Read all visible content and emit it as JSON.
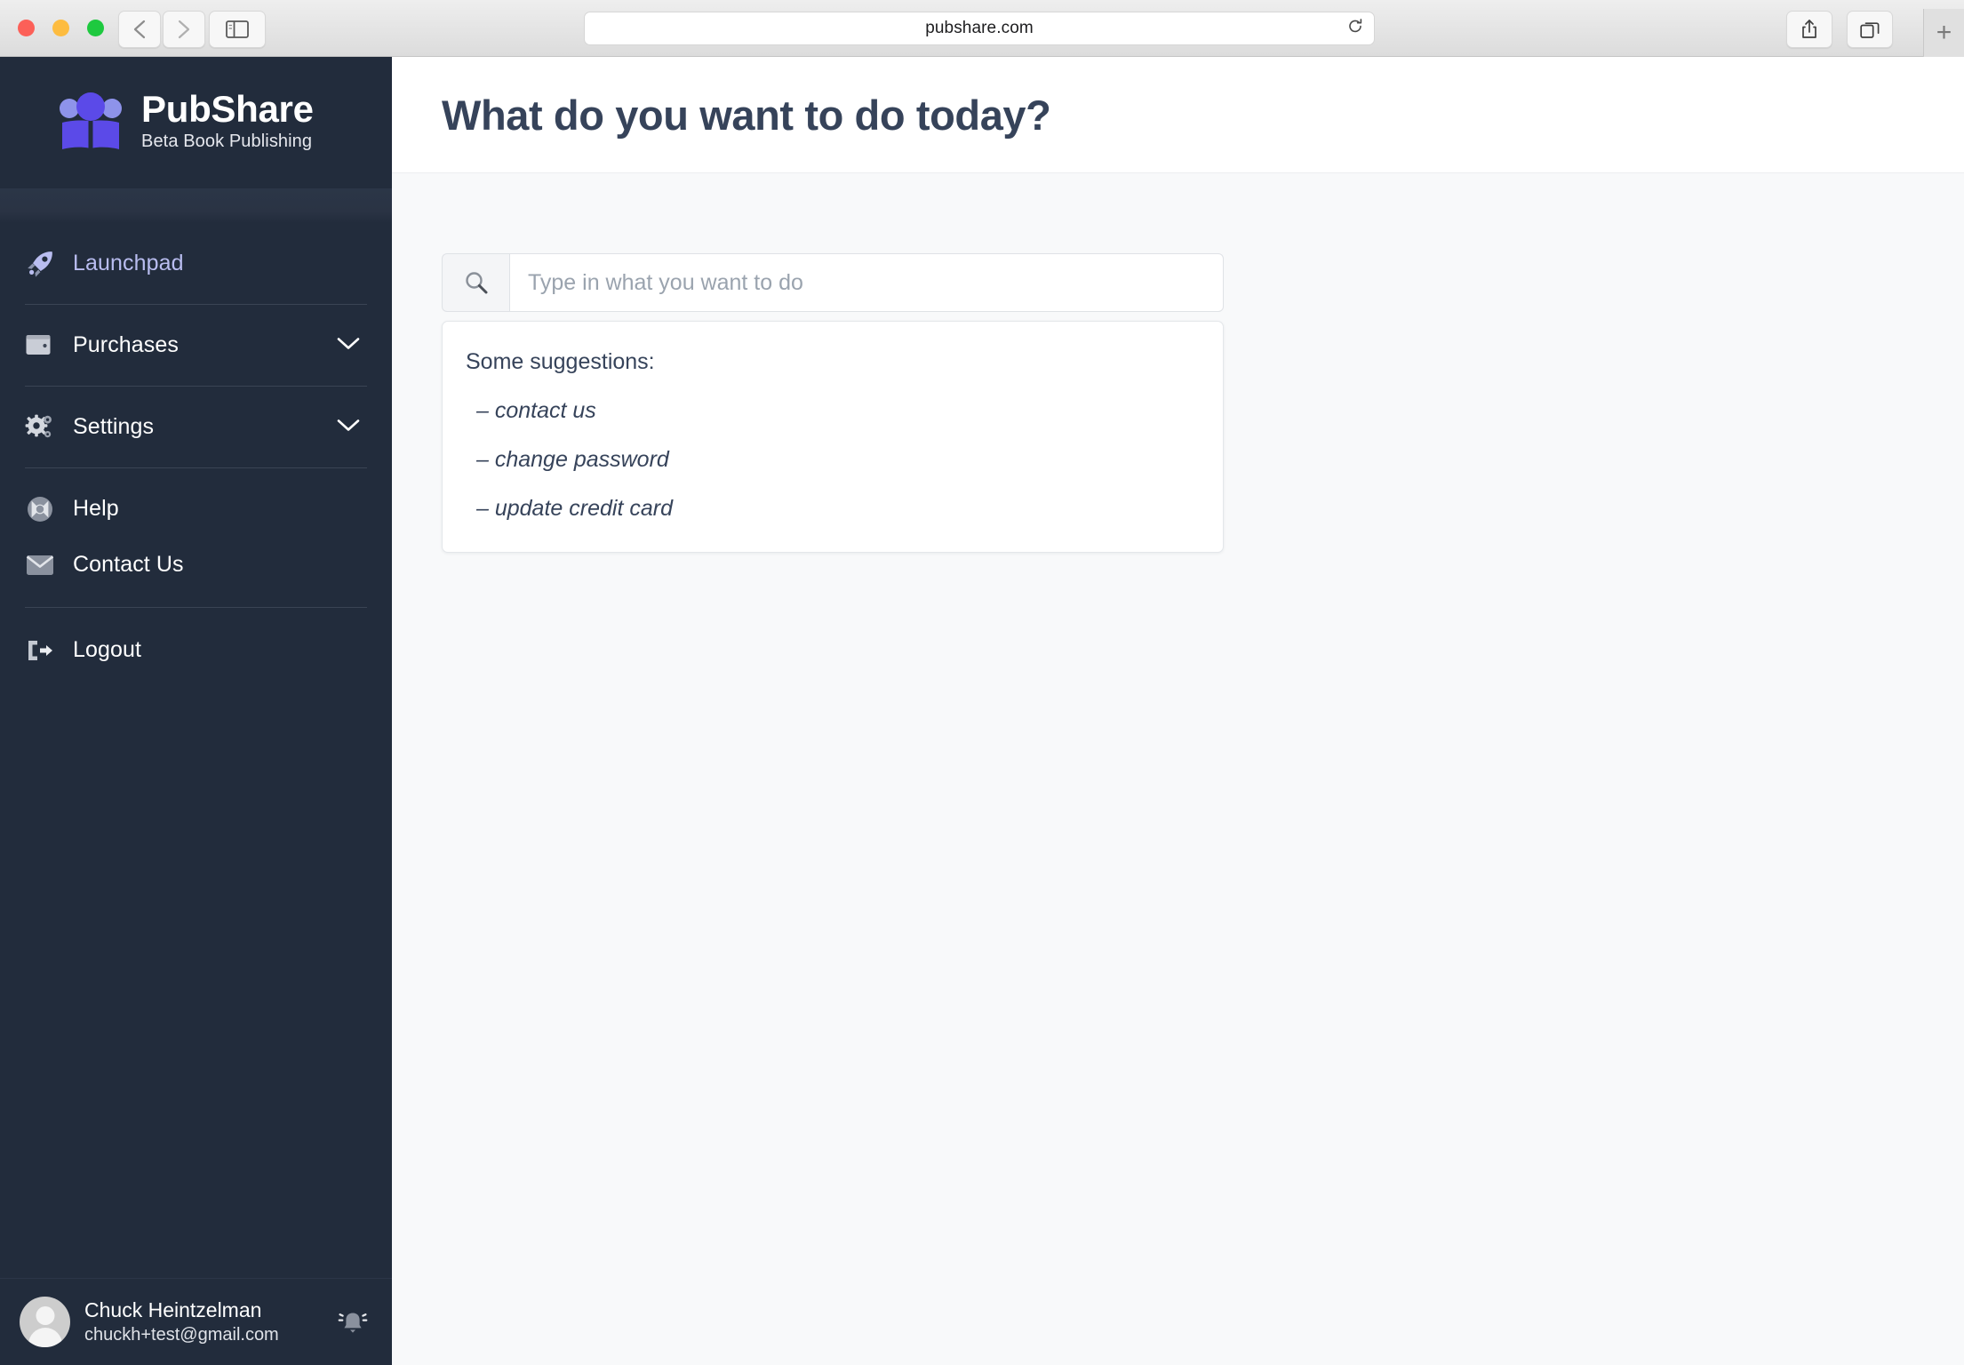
{
  "browser": {
    "url": "pubshare.com",
    "controls": {
      "back": "back-button",
      "forward": "forward-button",
      "sidebar": "sidebar-toggle",
      "reload": "reload-button",
      "share": "share-button",
      "tabs": "tab-overview-button",
      "new_tab": "+"
    }
  },
  "sidebar": {
    "brand": {
      "name": "PubShare",
      "tagline": "Beta Book Publishing"
    },
    "items": [
      {
        "label": "Launchpad",
        "icon": "rocket-icon",
        "active": true,
        "chevron": false
      },
      {
        "label": "Purchases",
        "icon": "wallet-icon",
        "active": false,
        "chevron": true
      },
      {
        "label": "Settings",
        "icon": "gears-icon",
        "active": false,
        "chevron": true
      },
      {
        "label": "Help",
        "icon": "life-ring-icon",
        "active": false,
        "chevron": false
      },
      {
        "label": "Contact Us",
        "icon": "envelope-icon",
        "active": false,
        "chevron": false
      },
      {
        "label": "Logout",
        "icon": "sign-out-icon",
        "active": false,
        "chevron": false
      }
    ],
    "user": {
      "name": "Chuck Heintzelman",
      "email": "chuckh+test@gmail.com",
      "avatar": "user-avatar-icon",
      "notification": "bell-icon"
    }
  },
  "main": {
    "title": "What do you want to do today?",
    "search": {
      "icon": "search-icon",
      "value": "",
      "placeholder": "Type in what you want to do"
    },
    "suggestions": {
      "title": "Some suggestions:",
      "items": [
        "– contact us",
        "– change password",
        "– update credit card"
      ]
    }
  },
  "colors": {
    "sidebar_bg": "#222c3c",
    "brand_purple": "#5b4ae8",
    "brand_purple_light": "#8e93ea",
    "active_nav": "#b9bdf0",
    "text_dark": "#36435a",
    "page_bg": "#f8f9fa"
  }
}
